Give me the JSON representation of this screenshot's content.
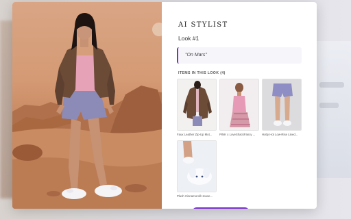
{
  "stylist": {
    "title": "AI STYLIST",
    "look_label": "Look #1",
    "prompt_quote": "\"On Mars\"",
    "items_heading": "ITEMS IN THIS LOOK (4)"
  },
  "items": [
    {
      "caption": "Faux Leather Zip-Up Mot...",
      "icon": "leather-jacket-icon"
    },
    {
      "caption": "PINK x LoveShackFancy ...",
      "icon": "pink-top-icon"
    },
    {
      "caption": "Hotty Hot Low-Rise Lined...",
      "icon": "shorts-icon"
    },
    {
      "caption": "Plush Cinnamoroll House...",
      "icon": "slippers-icon"
    }
  ],
  "colors": {
    "accent": "#7a2fd0",
    "mars_sky": "#d9a585",
    "mars_ground": "#b77a55"
  }
}
